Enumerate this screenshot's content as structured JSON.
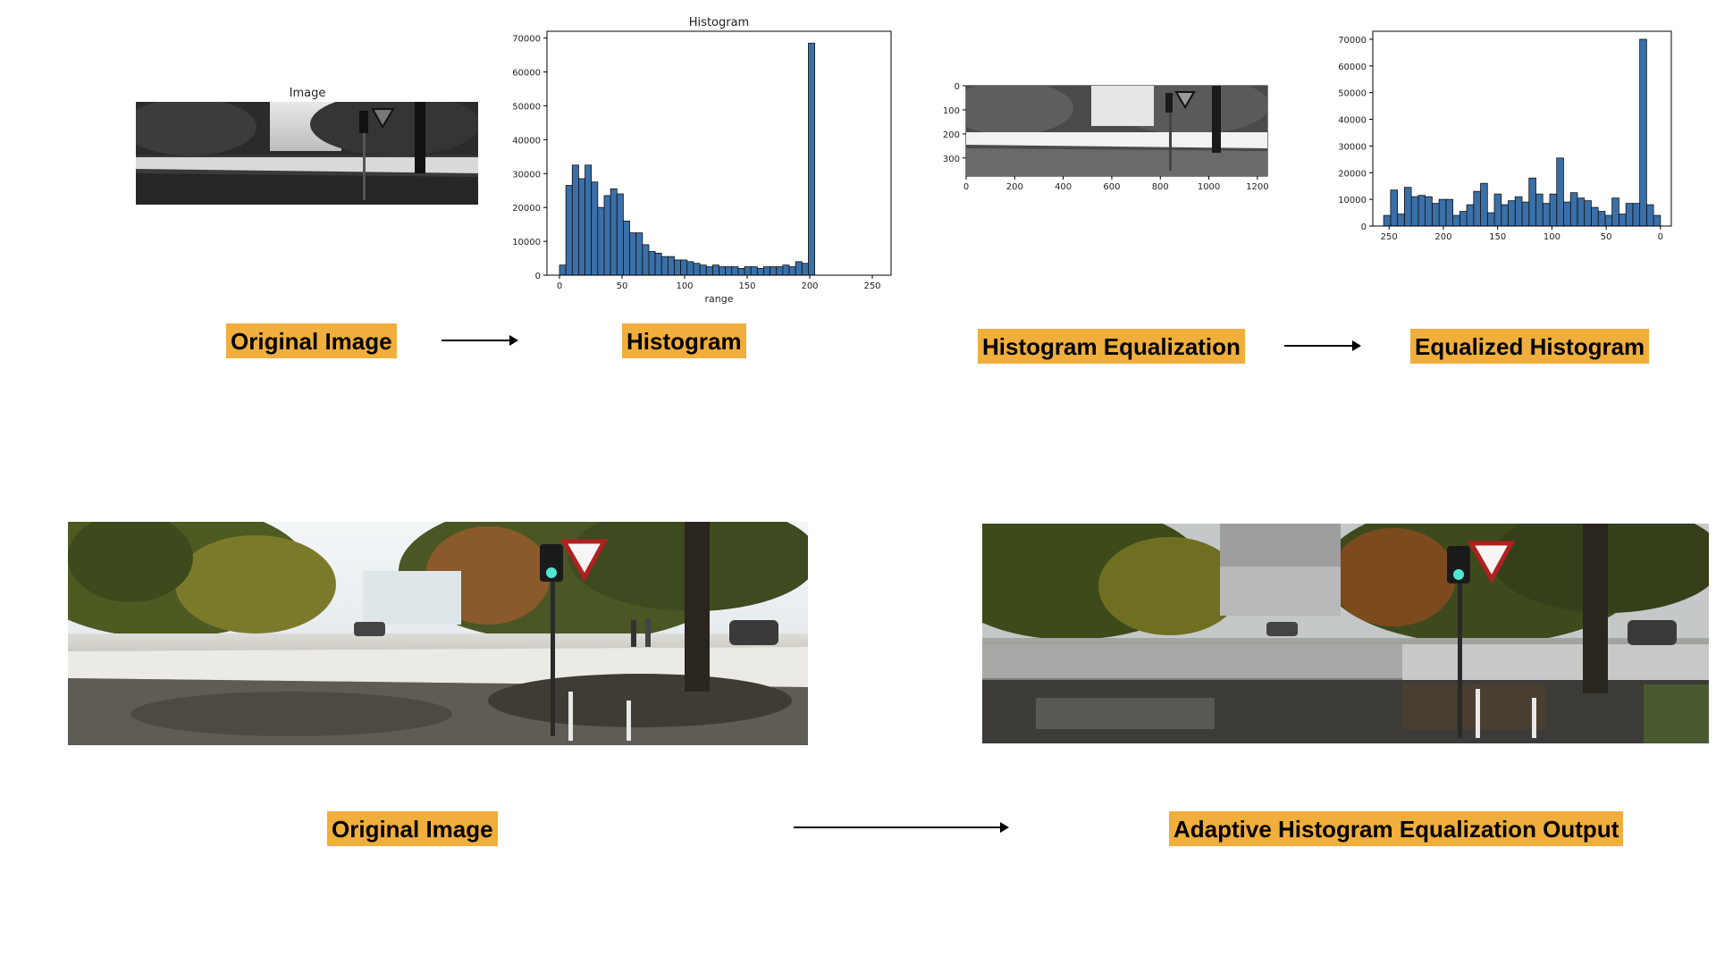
{
  "top_left": {
    "image_title": "Image",
    "label_original": "Original Image",
    "label_histogram": "Histogram"
  },
  "top_right": {
    "label_equalization": "Histogram Equalization",
    "label_equalized": "Equalized Histogram"
  },
  "bottom": {
    "label_original": "Original Image",
    "label_output": "Adaptive Histogram Equalization Output"
  },
  "colors": {
    "bar": "#3a6fa8",
    "label_bg": "#f0ae3c"
  },
  "chart_data": [
    {
      "type": "bar",
      "title": "Histogram",
      "xlabel": "range",
      "ylabel": "",
      "xlim": [
        -10,
        265
      ],
      "ylim": [
        0,
        72000
      ],
      "xticks": [
        0,
        50,
        100,
        150,
        200,
        250
      ],
      "yticks": [
        0,
        10000,
        20000,
        30000,
        40000,
        50000,
        60000,
        70000
      ],
      "bin_start": 0,
      "bin_width": 5.1,
      "values": [
        3000,
        26500,
        32500,
        28500,
        32500,
        27500,
        20000,
        23500,
        25500,
        24000,
        16000,
        12500,
        12500,
        9000,
        7000,
        6500,
        5500,
        5500,
        4500,
        4500,
        4000,
        3500,
        3000,
        2500,
        3000,
        2500,
        2500,
        2500,
        2000,
        2500,
        2500,
        2000,
        2500,
        2500,
        2500,
        3000,
        2500,
        4000,
        3500,
        68500
      ]
    },
    {
      "type": "bar",
      "title": "",
      "xlabel": "",
      "ylabel": "",
      "xlim": [
        265,
        -10
      ],
      "ylim": [
        0,
        73000
      ],
      "xticks": [
        250,
        200,
        150,
        100,
        50,
        0
      ],
      "yticks": [
        0,
        10000,
        20000,
        30000,
        40000,
        50000,
        60000,
        70000
      ],
      "bin_start": 0,
      "bin_width": 6.375,
      "values": [
        4000,
        8000,
        70000,
        8500,
        8500,
        4500,
        10500,
        4000,
        5500,
        7000,
        9500,
        10500,
        12500,
        9000,
        25500,
        12000,
        8500,
        12000,
        18000,
        9000,
        11000,
        9500,
        8000,
        12000,
        5000,
        16000,
        13000,
        8000,
        5500,
        4000,
        10000,
        10000,
        8500,
        11000,
        11500,
        11000,
        14500,
        4500,
        13500,
        4000
      ]
    },
    {
      "type": "axes",
      "title": "",
      "xlim": [
        0,
        1241
      ],
      "ylim": [
        375,
        0
      ],
      "xticks": [
        0,
        200,
        400,
        600,
        800,
        1000,
        1200
      ],
      "yticks": [
        0,
        100,
        200,
        300
      ]
    }
  ]
}
